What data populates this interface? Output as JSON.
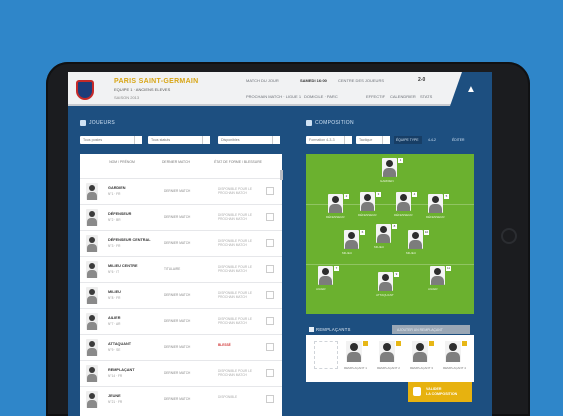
{
  "header": {
    "club_name": "PARIS SAINT-GERMAIN",
    "club_sub": "EQUIPE 1 · ANCIENS ELEVES",
    "club_sub2": "SAISON 2013",
    "match_label": "MATCH DU JOUR",
    "match_value": "SAMEDI 16:00",
    "venue": "CENTRE DES JOUEURS",
    "score": "2-0",
    "info_1": "PROCHAIN MATCH · LIGUE 1",
    "info_2": "DOMICILE · PARC",
    "nav_1": "EFFECTIF",
    "nav_2": "CALENDRIER",
    "nav_3": "STATS",
    "menu_label": "▲"
  },
  "players_section": {
    "title": "JOUEURS",
    "filters": [
      "Tous postes",
      "Tous statuts",
      "Disponibles"
    ],
    "columns": [
      "NOM / PRÉNOM",
      "DERNIER MATCH",
      "ÉTAT DE FORME / BLESSURE"
    ],
    "rows": [
      {
        "name": "GARDIEN",
        "sub": "N°1 · FR",
        "last": "DERNIER MATCH",
        "status": "DISPONIBLE POUR LE PROCHAIN MATCH",
        "flag": false
      },
      {
        "name": "DÉFENSEUR",
        "sub": "N°2 · BR",
        "last": "DERNIER MATCH",
        "status": "DISPONIBLE POUR LE PROCHAIN MATCH",
        "flag": false
      },
      {
        "name": "DÉFENSEUR CENTRAL",
        "sub": "N°3 · FR",
        "last": "DERNIER MATCH",
        "status": "DISPONIBLE POUR LE PROCHAIN MATCH",
        "flag": false
      },
      {
        "name": "MILIEU CENTRE",
        "sub": "N°6 · IT",
        "last": "TITULAIRE",
        "status": "DISPONIBLE POUR LE PROCHAIN MATCH",
        "flag": false
      },
      {
        "name": "MILIEU",
        "sub": "N°8 · FR",
        "last": "DERNIER MATCH",
        "status": "DISPONIBLE POUR LE PROCHAIN MATCH",
        "flag": false
      },
      {
        "name": "AILIER",
        "sub": "N°7 · AR",
        "last": "DERNIER MATCH",
        "status": "DISPONIBLE POUR LE PROCHAIN MATCH",
        "flag": false
      },
      {
        "name": "ATTAQUANT",
        "sub": "N°9 · SE",
        "last": "DERNIER MATCH",
        "status": "BLESSÉ",
        "flag": true
      },
      {
        "name": "REMPLAÇANT",
        "sub": "N°14 · FR",
        "last": "DERNIER MATCH",
        "status": "DISPONIBLE POUR LE PROCHAIN MATCH",
        "flag": false
      },
      {
        "name": "JEUNE",
        "sub": "N°21 · FR",
        "last": "DERNIER MATCH",
        "status": "DISPONIBLE",
        "flag": false
      }
    ]
  },
  "composition_section": {
    "title": "COMPOSITION",
    "filters": [
      "Formation 4-3-3",
      "Tactique"
    ],
    "toggles": [
      "ÉQUIPE TYPE",
      "4-4-2",
      "ÉDITER"
    ],
    "pitch_players": [
      {
        "name": "GARDIEN",
        "badge": "1"
      },
      {
        "name": "DÉFENSEUR",
        "badge": "2"
      },
      {
        "name": "DÉFENSEUR",
        "badge": "3"
      },
      {
        "name": "DÉFENSEUR",
        "badge": "4"
      },
      {
        "name": "DÉFENSEUR",
        "badge": "5"
      },
      {
        "name": "MILIEU",
        "badge": "6"
      },
      {
        "name": "MILIEU",
        "badge": "8"
      },
      {
        "name": "MILIEU",
        "badge": "10"
      },
      {
        "name": "AILIER",
        "badge": "7"
      },
      {
        "name": "ATTAQUANT",
        "badge": "9"
      },
      {
        "name": "AILIER",
        "badge": "11"
      }
    ]
  },
  "substitutes": {
    "title": "REMPLAÇANTS",
    "subtitle": "AJOUTER UN REMPLAÇANT",
    "players": [
      {
        "name": "REMPLAÇANT 1"
      },
      {
        "name": "REMPLAÇANT 2"
      },
      {
        "name": "REMPLAÇANT 3"
      },
      {
        "name": "REMPLAÇANT 4"
      }
    ]
  },
  "confirm_button": {
    "line1": "VALIDER",
    "line2": "LA COMPOSITION"
  },
  "colors": {
    "background": "#2f86c9",
    "app_blue": "#1d4f80",
    "pitch_green": "#6bb12f",
    "accent_gold": "#e7b20f",
    "alert_red": "#d23a3a"
  },
  "icons": [
    "club-crest-icon",
    "players-icon",
    "composition-icon",
    "substitutes-icon",
    "confirm-icon",
    "home-button-icon"
  ]
}
